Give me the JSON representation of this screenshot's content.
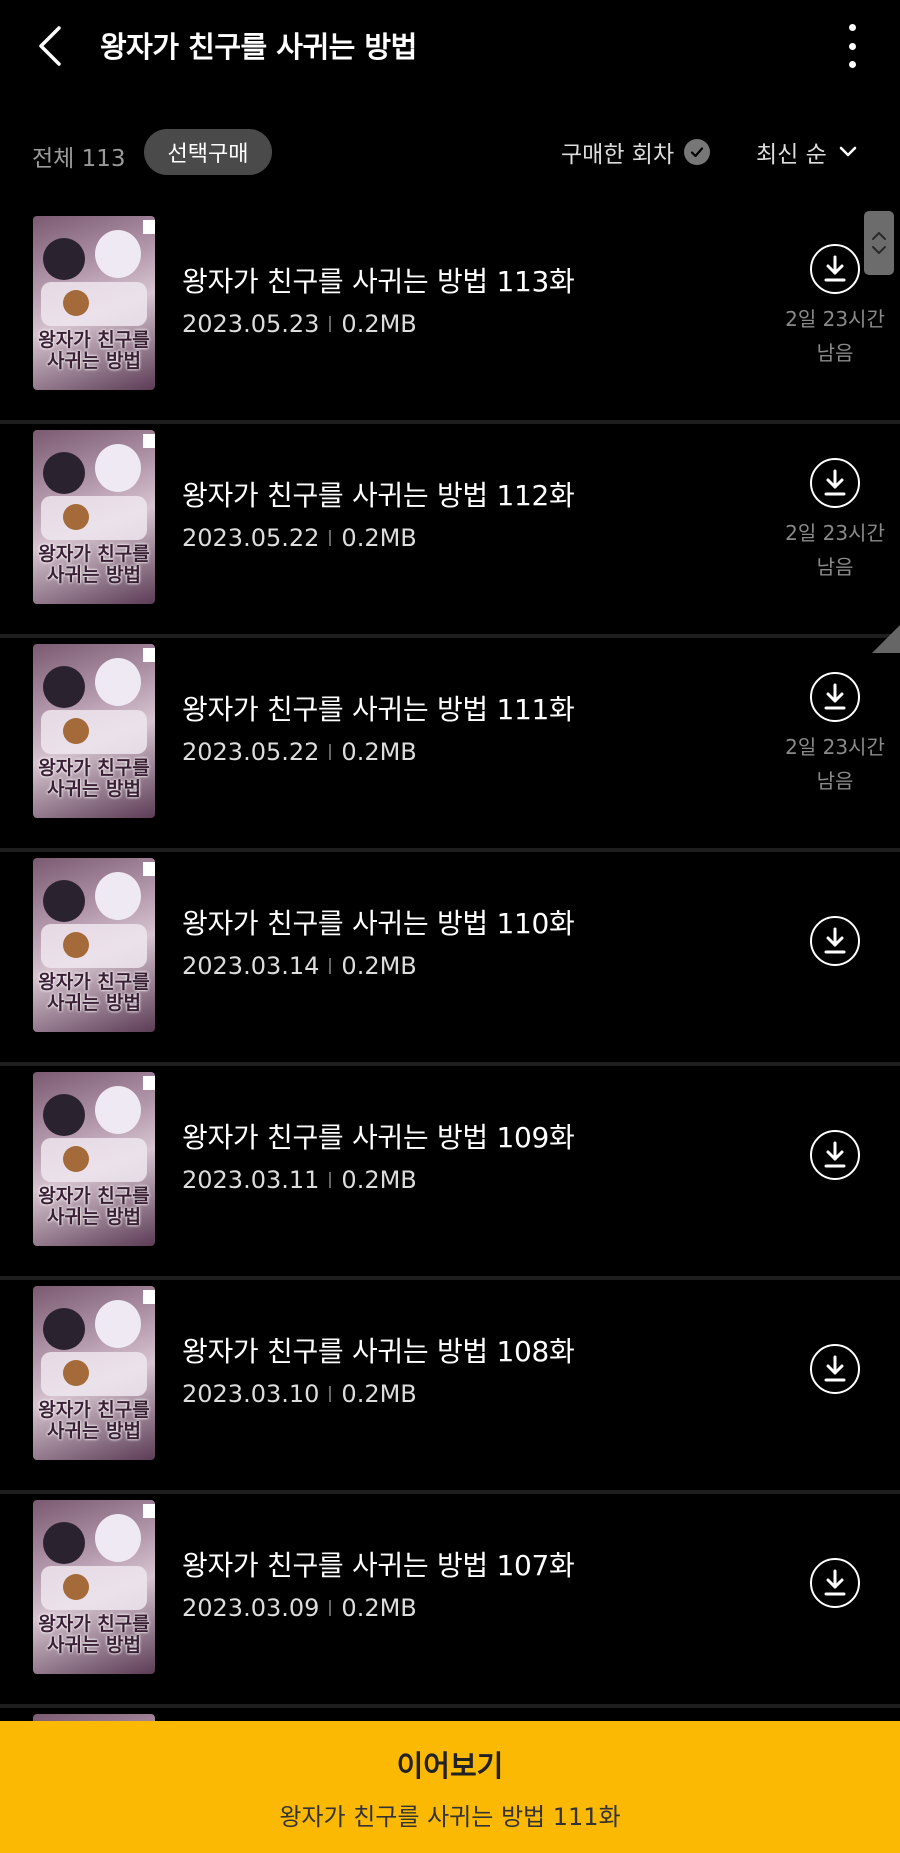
{
  "header": {
    "title": "왕자가 친구를 사귀는 방법",
    "back_icon": "back-arrow-icon",
    "more_icon": "more-vertical-icon"
  },
  "filter": {
    "total_label": "전체 113",
    "select_purchase": "선택구매",
    "purchased_filter": "구매한 회차",
    "sort_label": "최신 순"
  },
  "thumbnail": {
    "logo_text_line1": "왕자가 친구를",
    "logo_text_line2": "사귀는 방법"
  },
  "episodes": [
    {
      "title": "왕자가 친구를 사귀는 방법 113화",
      "date": "2023.05.23",
      "size": "0.2MB",
      "remain_1": "2일 23시간",
      "remain_2": "남음"
    },
    {
      "title": "왕자가 친구를 사귀는 방법 112화",
      "date": "2023.05.22",
      "size": "0.2MB",
      "remain_1": "2일 23시간",
      "remain_2": "남음"
    },
    {
      "title": "왕자가 친구를 사귀는 방법 111화",
      "date": "2023.05.22",
      "size": "0.2MB",
      "remain_1": "2일 23시간",
      "remain_2": "남음"
    },
    {
      "title": "왕자가 친구를 사귀는 방법 110화",
      "date": "2023.03.14",
      "size": "0.2MB"
    },
    {
      "title": "왕자가 친구를 사귀는 방법 109화",
      "date": "2023.03.11",
      "size": "0.2MB"
    },
    {
      "title": "왕자가 친구를 사귀는 방법 108화",
      "date": "2023.03.10",
      "size": "0.2MB"
    },
    {
      "title": "왕자가 친구를 사귀는 방법 107화",
      "date": "2023.03.09",
      "size": "0.2MB"
    }
  ],
  "continue": {
    "label": "이어보기",
    "episode": "왕자가 친구를 사귀는 방법 111화"
  },
  "colors": {
    "background": "#000000",
    "accent": "#fbb904",
    "chip": "#4a4a4a"
  }
}
